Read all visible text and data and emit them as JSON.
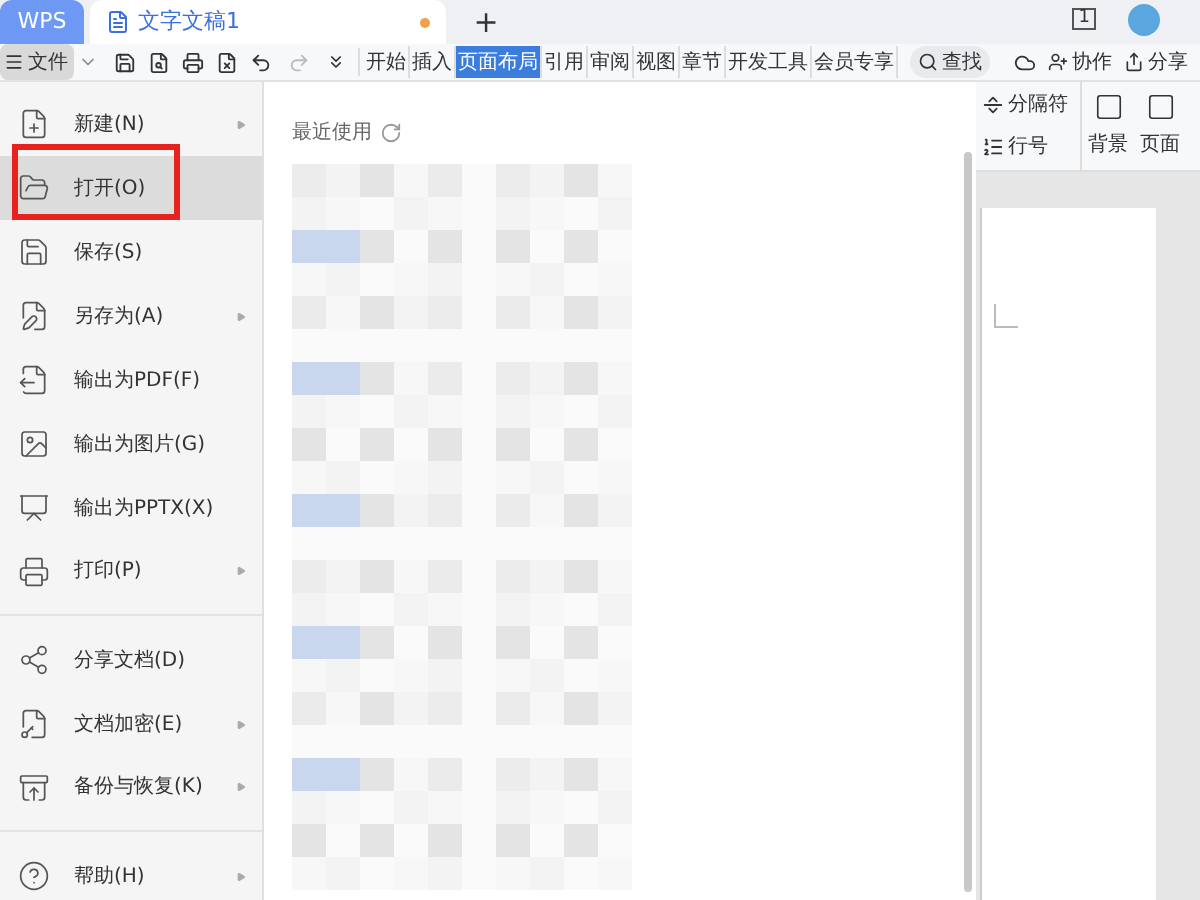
{
  "tabs": [
    {
      "label": "WPS",
      "kind": "app",
      "selected": false
    },
    {
      "label": "文字文稿1",
      "kind": "document",
      "selected": true,
      "unsaved": true
    }
  ],
  "new_tab": "+",
  "page_count": "1",
  "file_button": "文件",
  "ribbon_tabs": [
    {
      "label": "开始",
      "selected": false
    },
    {
      "label": "插入",
      "selected": false
    },
    {
      "label": "页面布局",
      "selected": true
    },
    {
      "label": "引用",
      "selected": false
    },
    {
      "label": "审阅",
      "selected": false
    },
    {
      "label": "视图",
      "selected": false
    },
    {
      "label": "章节",
      "selected": false
    },
    {
      "label": "开发工具",
      "selected": false
    },
    {
      "label": "会员专享",
      "selected": false
    }
  ],
  "search": "查找",
  "actions": [
    "协作",
    "分享"
  ],
  "ribbon_tools": [
    {
      "label": "分隔符",
      "kind": "small"
    },
    {
      "label": "行号",
      "kind": "small"
    },
    {
      "label": "背景",
      "kind": "large"
    },
    {
      "label": "页面",
      "kind": "large"
    }
  ],
  "menu": [
    {
      "label": "新建(N)",
      "kind": "new",
      "has_submenu": true,
      "selected": false,
      "outlined": false,
      "separator_after": false
    },
    {
      "label": "打开(O)",
      "kind": "open",
      "has_submenu": false,
      "selected": true,
      "outlined": true,
      "separator_after": false
    },
    {
      "label": "保存(S)",
      "kind": "save",
      "has_submenu": false,
      "selected": false,
      "outlined": false,
      "separator_after": false
    },
    {
      "label": "另存为(A)",
      "kind": "saveas",
      "has_submenu": true,
      "selected": false,
      "outlined": false,
      "separator_after": false
    },
    {
      "label": "输出为PDF(F)",
      "kind": "pdf",
      "has_submenu": false,
      "selected": false,
      "outlined": false,
      "separator_after": false
    },
    {
      "label": "输出为图片(G)",
      "kind": "image",
      "has_submenu": false,
      "selected": false,
      "outlined": false,
      "separator_after": false
    },
    {
      "label": "输出为PPTX(X)",
      "kind": "pptx",
      "has_submenu": false,
      "selected": false,
      "outlined": false,
      "separator_after": false
    },
    {
      "label": "打印(P)",
      "kind": "print",
      "has_submenu": true,
      "selected": false,
      "outlined": false,
      "separator_after": true
    },
    {
      "label": "分享文档(D)",
      "kind": "share",
      "has_submenu": false,
      "selected": false,
      "outlined": false,
      "separator_after": false
    },
    {
      "label": "文档加密(E)",
      "kind": "encrypt",
      "has_submenu": true,
      "selected": false,
      "outlined": false,
      "separator_after": false
    },
    {
      "label": "备份与恢复(K)",
      "kind": "backup",
      "has_submenu": true,
      "selected": false,
      "outlined": false,
      "separator_after": true
    },
    {
      "label": "帮助(H)",
      "kind": "help",
      "has_submenu": true,
      "selected": false,
      "outlined": false,
      "separator_after": false
    }
  ],
  "recent": {
    "title": "最近使用"
  }
}
